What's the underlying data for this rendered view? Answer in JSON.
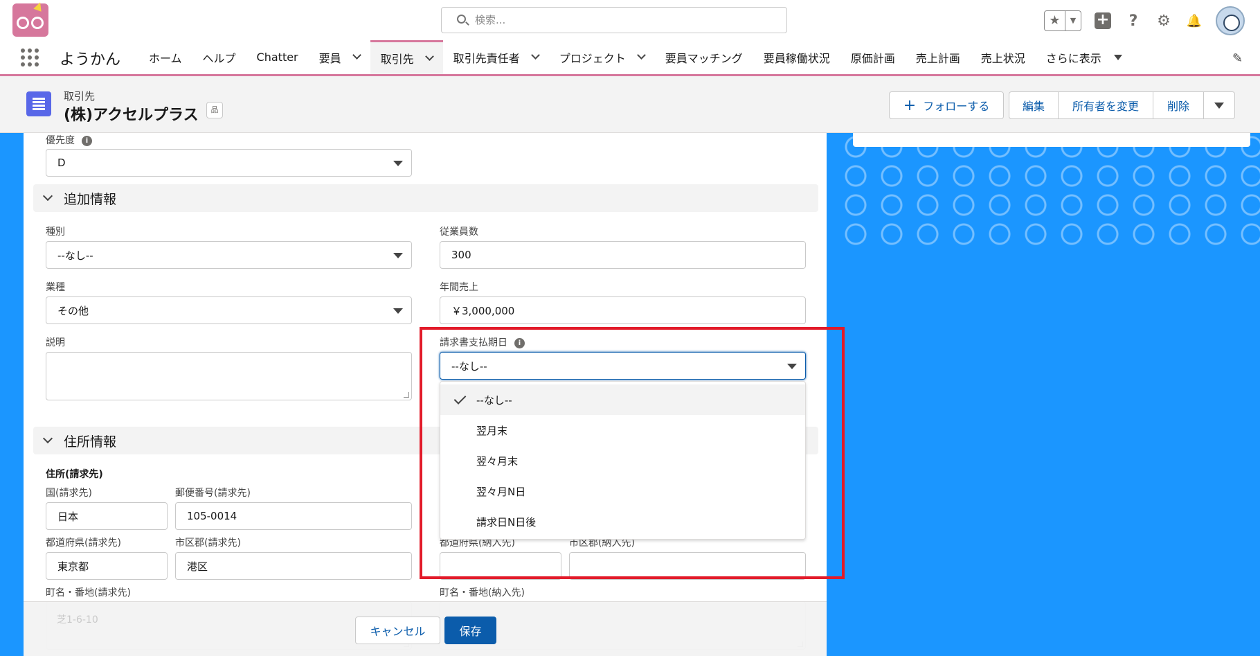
{
  "header": {
    "search_placeholder": "検索...",
    "fav_star": "★",
    "fav_caret": "▼",
    "help_glyph": "?",
    "settings_glyph": "⚙",
    "bell_glyph": "🔔"
  },
  "nav": {
    "app_name": "ようかん",
    "items": [
      "ホーム",
      "ヘルプ",
      "Chatter",
      "要員",
      "取引先",
      "取引先責任者",
      "プロジェクト",
      "要員マッチング",
      "要員稼働状況",
      "原価計画",
      "売上計画",
      "売上状況",
      "さらに表示"
    ],
    "active": "取引先",
    "edit_glyph": "✎"
  },
  "record": {
    "object_type": "取引先",
    "name": "(株)アクセルプラス",
    "hierarchy_glyph": "品",
    "actions": {
      "follow": "フォローする",
      "edit": "編集",
      "change_owner": "所有者を変更",
      "delete": "削除"
    }
  },
  "form": {
    "priority": {
      "label": "優先度",
      "value": "D"
    },
    "section_additional": "追加情報",
    "type": {
      "label": "種別",
      "value": "--なし--"
    },
    "employees": {
      "label": "従業員数",
      "value": "300"
    },
    "industry": {
      "label": "業種",
      "value": "その他"
    },
    "annual_revenue": {
      "label": "年間売上",
      "value": "￥3,000,000"
    },
    "description": {
      "label": "説明",
      "value": ""
    },
    "invoice_due": {
      "label": "請求書支払期日",
      "value": "--なし--",
      "options": [
        "--なし--",
        "翌月末",
        "翌々月末",
        "翌々月N日",
        "請求日N日後"
      ],
      "selected_index": 0
    },
    "section_address": "住所情報",
    "billing_address": {
      "title": "住所(請求先)",
      "country": {
        "label": "国(請求先)",
        "value": "日本"
      },
      "postal": {
        "label": "郵便番号(請求先)",
        "value": "105-0014"
      },
      "state": {
        "label": "都道府県(請求先)",
        "value": "東京都"
      },
      "city": {
        "label": "市区郡(請求先)",
        "value": "港区"
      },
      "street": {
        "label": "町名・番地(請求先)",
        "value": "芝1-6-10"
      }
    },
    "shipping_address": {
      "state": {
        "label": "都道府県(納入先)",
        "value": ""
      },
      "city": {
        "label": "市区郡(納入先)",
        "value": ""
      },
      "street": {
        "label": "町名・番地(納入先)",
        "value": ""
      }
    },
    "info_glyph": "i"
  },
  "footer": {
    "cancel": "キャンセル",
    "save": "保存"
  },
  "colors": {
    "brand": "#d6779c",
    "accent": "#0b5cab",
    "background": "#1b96ff",
    "highlight": "#e21b2a"
  }
}
